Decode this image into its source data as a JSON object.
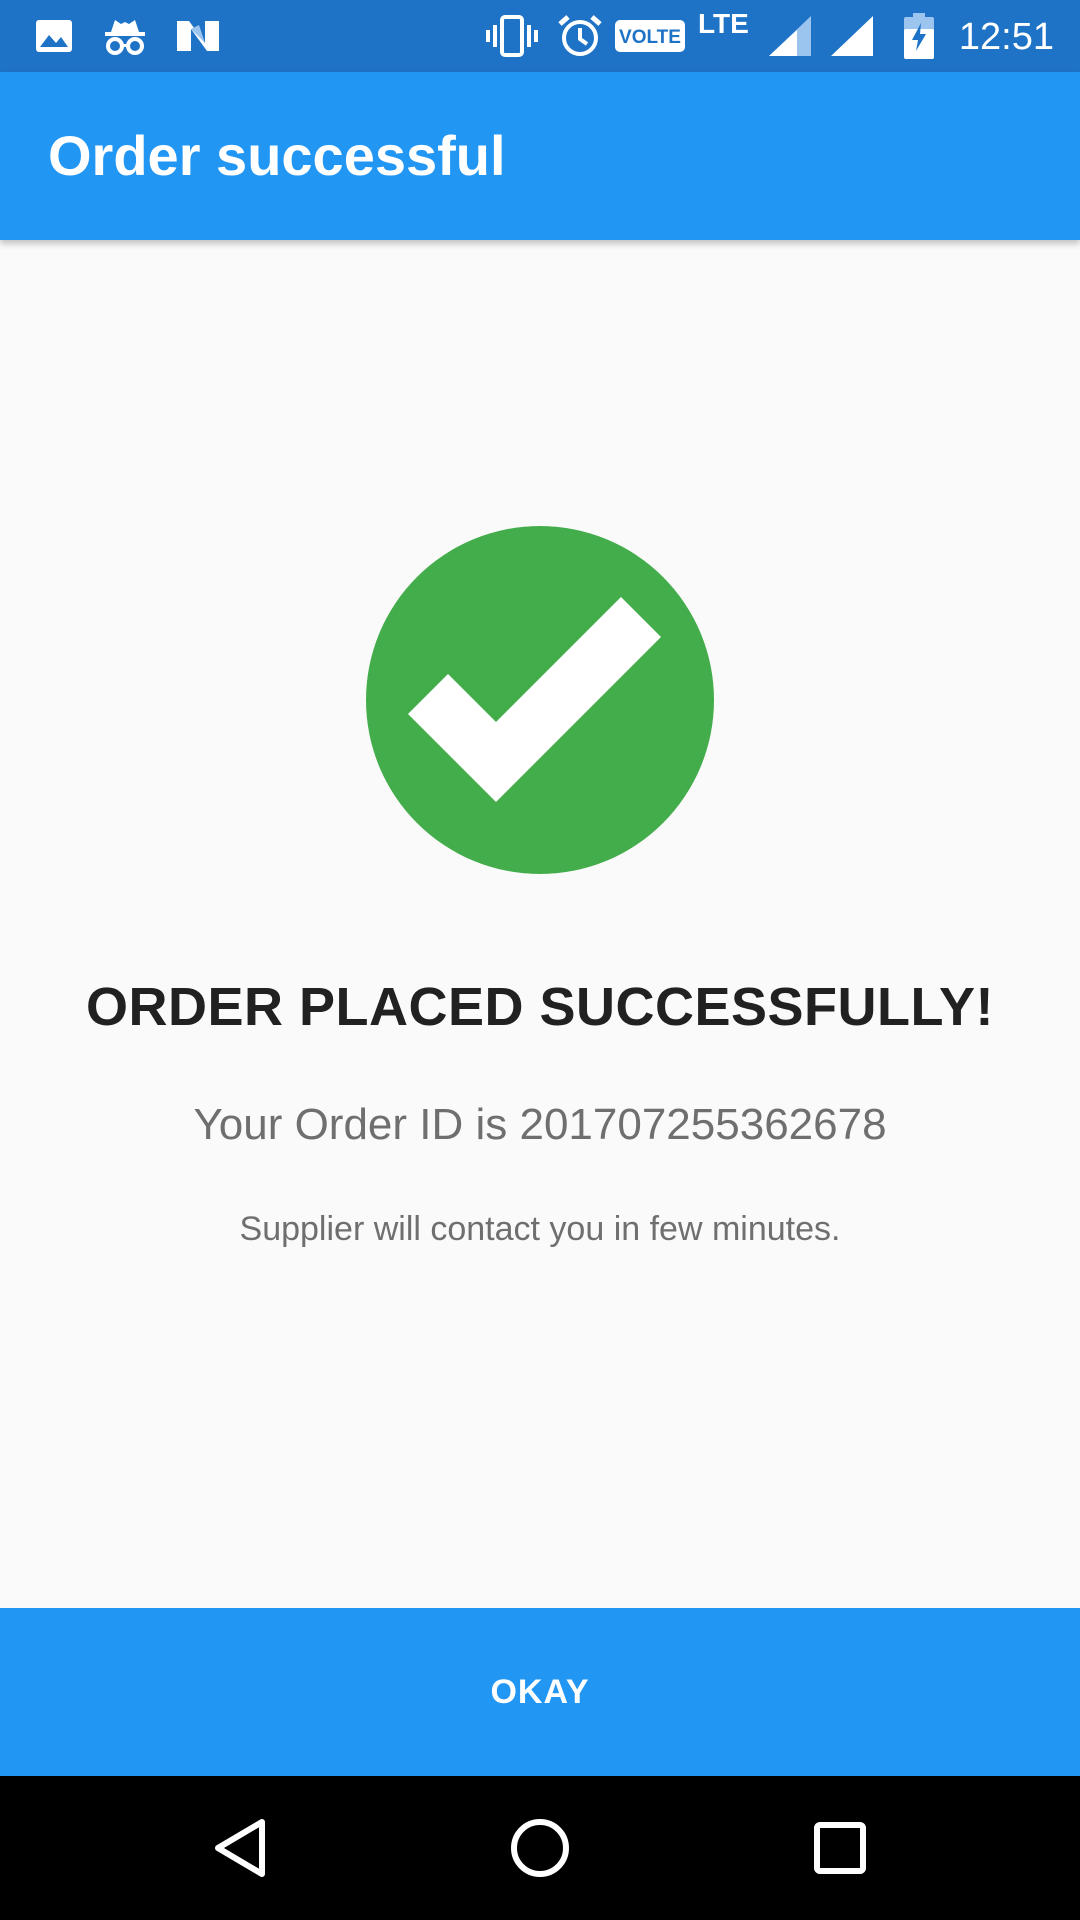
{
  "status_bar": {
    "time": "12:51",
    "network_label": "LTE",
    "volte_label": "VOLTE",
    "icons": [
      "image-icon",
      "incognito-icon",
      "nougat-icon",
      "vibrate-icon",
      "alarm-icon",
      "volte-icon",
      "signal-icon",
      "signal-icon",
      "battery-charging-icon"
    ]
  },
  "app_bar": {
    "title": "Order successful"
  },
  "content": {
    "icon": "check-circle-icon",
    "headline": "ORDER PLACED SUCCESSFULLY!",
    "order_id_text": "Your Order ID is 201707255362678",
    "supplier_note": "Supplier will contact you in few minutes."
  },
  "actions": {
    "okay_label": "OKAY"
  },
  "nav_bar": {
    "icons": [
      "back-icon",
      "home-icon",
      "recents-icon"
    ]
  },
  "colors": {
    "status_bar": "#1e73c6",
    "primary": "#2196f3",
    "success": "#43ad4c",
    "headline_text": "#212121",
    "secondary_text": "#6f6f6f",
    "background": "#fafafa"
  }
}
